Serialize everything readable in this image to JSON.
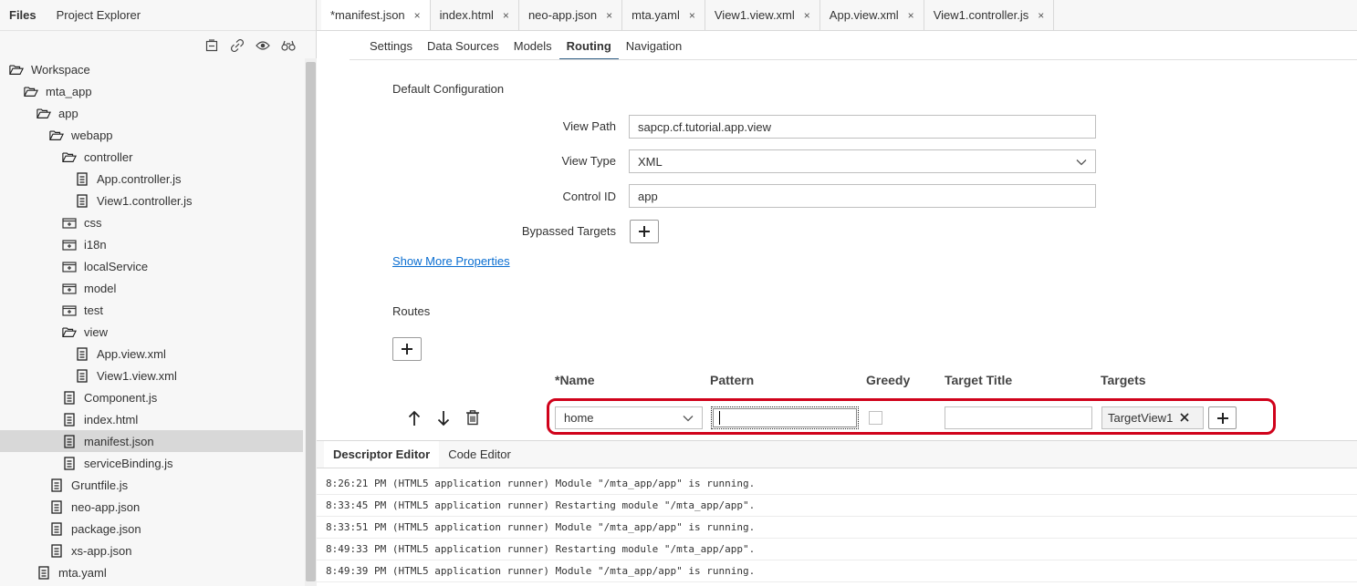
{
  "sidebar": {
    "tabs": [
      {
        "label": "Files"
      },
      {
        "label": "Project Explorer"
      }
    ],
    "toolbar_icons": [
      "collapse-all-icon",
      "link-icon",
      "eye-icon",
      "binoculars-icon"
    ],
    "tree": [
      {
        "label": "Workspace",
        "icon": "folder-open-icon"
      },
      {
        "label": "mta_app",
        "icon": "folder-open-icon"
      },
      {
        "label": "app",
        "icon": "folder-open-icon"
      },
      {
        "label": "webapp",
        "icon": "folder-open-icon"
      },
      {
        "label": "controller",
        "icon": "folder-open-icon"
      },
      {
        "label": "App.controller.js",
        "icon": "file-icon"
      },
      {
        "label": "View1.controller.js",
        "icon": "file-icon"
      },
      {
        "label": "css",
        "icon": "folder-closed-icon"
      },
      {
        "label": "i18n",
        "icon": "folder-closed-icon"
      },
      {
        "label": "localService",
        "icon": "folder-closed-icon"
      },
      {
        "label": "model",
        "icon": "folder-closed-icon"
      },
      {
        "label": "test",
        "icon": "folder-closed-icon"
      },
      {
        "label": "view",
        "icon": "folder-open-icon"
      },
      {
        "label": "App.view.xml",
        "icon": "file-icon"
      },
      {
        "label": "View1.view.xml",
        "icon": "file-icon"
      },
      {
        "label": "Component.js",
        "icon": "file-icon"
      },
      {
        "label": "index.html",
        "icon": "file-icon"
      },
      {
        "label": "manifest.json",
        "icon": "file-icon",
        "selected": true
      },
      {
        "label": "serviceBinding.js",
        "icon": "file-icon"
      },
      {
        "label": "Gruntfile.js",
        "icon": "file-icon"
      },
      {
        "label": "neo-app.json",
        "icon": "file-icon"
      },
      {
        "label": "package.json",
        "icon": "file-icon"
      },
      {
        "label": "xs-app.json",
        "icon": "file-icon"
      },
      {
        "label": "mta.yaml",
        "icon": "file-icon"
      }
    ]
  },
  "editor_tabs": [
    {
      "label": "*manifest.json",
      "close": "×"
    },
    {
      "label": "index.html",
      "close": "×"
    },
    {
      "label": "neo-app.json",
      "close": "×"
    },
    {
      "label": "mta.yaml",
      "close": "×"
    },
    {
      "label": "View1.view.xml",
      "close": "×"
    },
    {
      "label": "App.view.xml",
      "close": "×"
    },
    {
      "label": "View1.controller.js",
      "close": "×"
    }
  ],
  "sub_tabs": [
    {
      "label": "Settings"
    },
    {
      "label": "Data Sources"
    },
    {
      "label": "Models"
    },
    {
      "label": "Routing",
      "active": true
    },
    {
      "label": "Navigation"
    }
  ],
  "routing": {
    "section_default": "Default Configuration",
    "view_path_label": "View Path",
    "view_path_value": "sapcp.cf.tutorial.app.view",
    "view_type_label": "View Type",
    "view_type_value": "XML",
    "control_id_label": "Control ID",
    "control_id_value": "app",
    "bypassed_targets_label": "Bypassed Targets",
    "show_more_link": "Show More Properties",
    "section_routes": "Routes",
    "columns": {
      "name": "*Name",
      "pattern": "Pattern",
      "greedy": "Greedy",
      "target_title": "Target Title",
      "targets": "Targets"
    },
    "route": {
      "name": "home",
      "pattern": "",
      "greedy": false,
      "target_title": "",
      "target_token": "TargetView1"
    },
    "highlight_color": "#d0021b"
  },
  "bottom_tabs": [
    {
      "label": "Descriptor Editor",
      "active": true
    },
    {
      "label": "Code Editor"
    }
  ],
  "console": [
    "8:26:21 PM (HTML5 application runner) Module \"/mta_app/app\" is running.",
    "8:33:45 PM (HTML5 application runner) Restarting module \"/mta_app/app\".",
    "8:33:51 PM (HTML5 application runner) Module \"/mta_app/app\" is running.",
    "8:49:33 PM (HTML5 application runner) Restarting module \"/mta_app/app\".",
    "8:49:39 PM (HTML5 application runner) Module \"/mta_app/app\" is running."
  ]
}
